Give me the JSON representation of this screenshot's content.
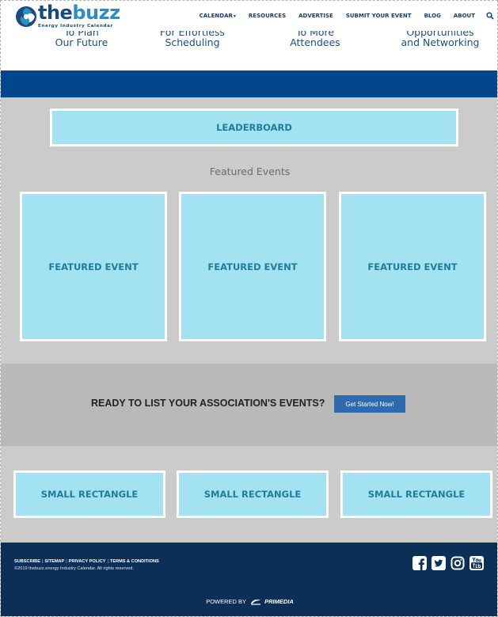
{
  "header": {
    "logo": {
      "prefix": "the",
      "name": "buzz",
      "tagline": "Energy Industry Calendar"
    },
    "nav": [
      {
        "label": "CALENDAR",
        "has_caret": true
      },
      {
        "label": "RESOURCES"
      },
      {
        "label": "ADVERTISE"
      },
      {
        "label": "SUBMIT YOUR EVENT"
      },
      {
        "label": "BLOG"
      },
      {
        "label": "ABOUT"
      }
    ],
    "search_icon": "search-icon"
  },
  "benefits": [
    {
      "line1": "To Plan",
      "line2": "Our Future"
    },
    {
      "line1": "For Effortless",
      "line2": "Scheduling"
    },
    {
      "line1": "To More",
      "line2": "Attendees"
    },
    {
      "line1": "Opportunities",
      "line2": "and Networking"
    }
  ],
  "ads": {
    "leaderboard": "LEADERBOARD",
    "featured_heading": "Featured Events",
    "featured": [
      "FEATURED EVENT",
      "FEATURED EVENT",
      "FEATURED EVENT"
    ],
    "small": [
      "SMALL RECTANGLE",
      "SMALL RECTANGLE",
      "SMALL RECTANGLE"
    ]
  },
  "cta": {
    "text": "READY TO LIST YOUR ASSOCIATION'S EVENTS?",
    "button": "Get Started Now!"
  },
  "footer": {
    "links": [
      "SUBSCRIBE",
      "SITEMAP",
      "PRIVACY POLICY",
      "TERMS & CONDITIONS"
    ],
    "separator": "|",
    "copyright": "©2019 thebuzz.energy Industry Calendar. All rights reserved.",
    "socials": [
      "facebook-icon",
      "twitter-icon",
      "instagram-icon",
      "youtube-icon"
    ],
    "powered_by": "POWERED BY",
    "powered_brand": "PRIMEDIA"
  },
  "colors": {
    "nav_text": "#163f73",
    "blue_band": "#03468b",
    "ad_fill": "#a3e2f1",
    "ad_text": "#1f7d98",
    "page_grey": "#cbcbcb",
    "cta_grey": "#b9b9b9",
    "cta_button": "#2d6bb0",
    "footer_bg": "#0c2f57"
  }
}
